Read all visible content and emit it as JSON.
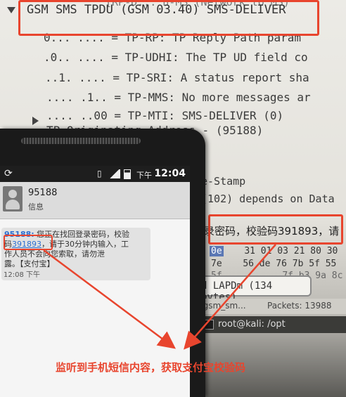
{
  "wireshark": {
    "top_partial": "[RP-D...  n-MS (Network to MS)",
    "tpdu_header": "GSM SMS TPDU (GSM 03.40) SMS-DELIVER",
    "fields": [
      "0... .... = TP-RP: TP Reply Path param",
      ".0.. .... = TP-UDHI: The TP UD field co",
      "..1. .... = TP-SRI: A status report sha",
      ".... .1.. = TP-MMS: No more messages ar",
      ".... ..00 = TP-MTI: SMS-DELIVER (0)"
    ],
    "originating": "TP-Originating-Address - (95188)",
    "timestamp_field": "e-Stamp",
    "data_field": "(102) depends on Data",
    "decoded_text": "录密码，校验码391893，请",
    "hex_rows": [
      [
        "0e",
        "31",
        "01",
        "03",
        "21",
        "80",
        "30"
      ],
      [
        "7e",
        "56",
        "de",
        "76",
        "7b",
        "5f",
        "55"
      ],
      [
        "5f",
        "",
        "",
        "7f",
        "b3",
        "9a",
        "8c"
      ]
    ],
    "frame_status": "d LAPDm (134 bytes)",
    "status_left": "(gsm_sm...",
    "status_packets": "Packets: 13988",
    "terminal": "root@kali: /opt"
  },
  "phone": {
    "status_am_pm": "下午",
    "status_time": "12:04",
    "contact_name": "95188",
    "contact_sub": "信息",
    "sms": {
      "sender": "95188:",
      "line1": " 您正在找回登录密码，校验",
      "code_prefix": "码",
      "code": "391893",
      "line2": "，请于30分钟内输入，工",
      "line3": "作人员不会向您索取，请勿泄",
      "line4": "露。【支付宝】",
      "time": "12:08 下午"
    }
  },
  "caption": "监听到手机短信内容，获取支付宝校验码",
  "colors": {
    "highlight_red": "#e8452e",
    "link_blue": "#2c6fd1",
    "hex_select": "#5b78b5"
  }
}
